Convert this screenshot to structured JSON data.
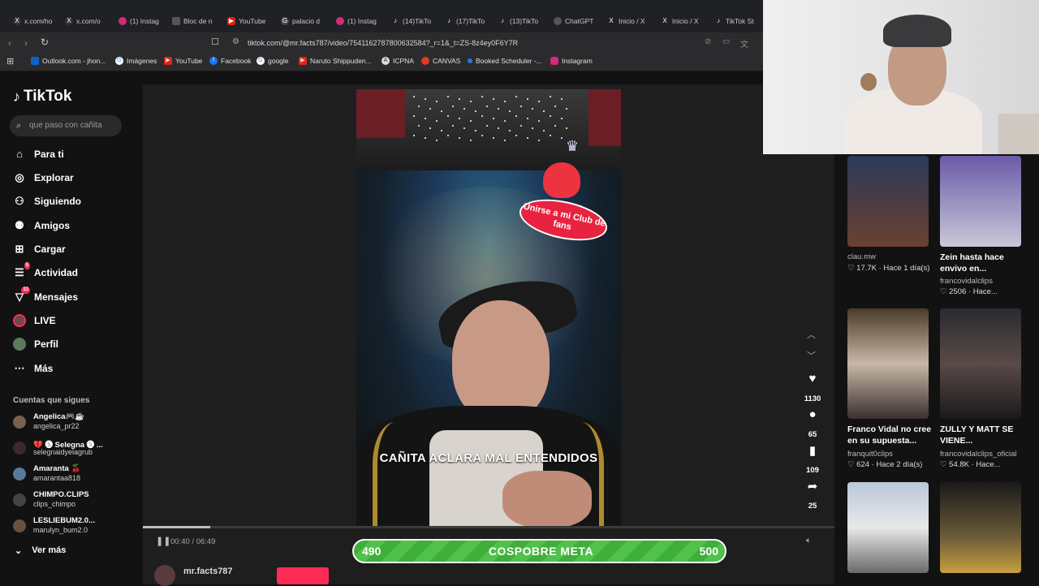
{
  "browser": {
    "tabs": [
      {
        "label": "x.com/ho",
        "icon": "x-icon"
      },
      {
        "label": "x.com/o",
        "icon": "x-icon"
      },
      {
        "label": "(1) Instag",
        "icon": "instagram-icon"
      },
      {
        "label": "Bloc de n",
        "icon": "notepad-icon"
      },
      {
        "label": "YouTube",
        "icon": "youtube-icon"
      },
      {
        "label": "palacio d",
        "icon": "google-icon"
      },
      {
        "label": "(1) Instag",
        "icon": "instagram-icon"
      },
      {
        "label": "(14)TikTo",
        "icon": "tiktok-icon"
      },
      {
        "label": "(17)TikTo",
        "icon": "tiktok-icon"
      },
      {
        "label": "(13)TikTo",
        "icon": "tiktok-icon"
      },
      {
        "label": "ChatGPT",
        "icon": "chatgpt-icon"
      },
      {
        "label": "Inicio / X",
        "icon": "x-icon"
      },
      {
        "label": "Inicio / X",
        "icon": "x-icon"
      },
      {
        "label": "TikTok St",
        "icon": "tiktok-icon"
      }
    ],
    "url": "tiktok.com/@mr.facts787/video/7541162787800632584?_r=1&_t=ZS-8z4ey0F6Y7R",
    "bookmarks": [
      {
        "label": "Outlook.com - jhon...",
        "icon": "outlook-icon"
      },
      {
        "label": "Imágenes",
        "icon": "google-icon"
      },
      {
        "label": "YouTube",
        "icon": "youtube-icon"
      },
      {
        "label": "Facebook",
        "icon": "facebook-icon"
      },
      {
        "label": "google",
        "icon": "google-icon"
      },
      {
        "label": "Naruto Shippuden...",
        "icon": "youtube-icon"
      },
      {
        "label": "ICPNA",
        "icon": "icpna-icon"
      },
      {
        "label": "CANVAS",
        "icon": "canvas-icon"
      },
      {
        "label": "Booked Scheduler -...",
        "icon": "booked-icon"
      },
      {
        "label": "Instagram",
        "icon": "instagram-icon"
      }
    ]
  },
  "sidebar": {
    "logo": "TikTok",
    "search_placeholder": "que paso con cañita",
    "nav": [
      {
        "label": "Para ti",
        "icon": "home-icon"
      },
      {
        "label": "Explorar",
        "icon": "compass-icon"
      },
      {
        "label": "Siguiendo",
        "icon": "following-icon"
      },
      {
        "label": "Amigos",
        "icon": "friends-icon"
      },
      {
        "label": "Cargar",
        "icon": "upload-icon"
      },
      {
        "label": "Actividad",
        "icon": "activity-icon",
        "badge": "5"
      },
      {
        "label": "Mensajes",
        "icon": "messages-icon",
        "badge": "13"
      },
      {
        "label": "LIVE",
        "icon": "live-icon"
      },
      {
        "label": "Perfil",
        "icon": "profile-icon"
      },
      {
        "label": "Más",
        "icon": "more-icon"
      }
    ],
    "following_title": "Cuentas que sigues",
    "accounts": [
      {
        "name": "Angelica🎮☕",
        "handle": "angelica_pr22"
      },
      {
        "name": "💔 🅢 Selegna 🅢 ...",
        "handle": "selegnaidyelagrub"
      },
      {
        "name": "Amaranta 🍒",
        "handle": "amarantaa818"
      },
      {
        "name": "CHIMPO.CLIPS",
        "handle": "clips_chimpo"
      },
      {
        "name": "LESLIEBUM2.0...",
        "handle": "marulyn_bum2.0"
      }
    ],
    "see_more": "Ver más"
  },
  "video": {
    "caption": "CAÑITA ACLARA MAL ENTENDIDOS",
    "fan_club": "Unirse a mi Club de fans",
    "time": "00:40 / 06:49",
    "progress": 0.098,
    "author": "mr.facts787"
  },
  "meta_bar": {
    "current": "490",
    "label": "COSPOBRE META",
    "goal": "500",
    "fraction": 0.98
  },
  "actions": {
    "likes": "1130",
    "comments": "65",
    "saves": "109",
    "shares": "25"
  },
  "recommended": [
    {
      "title": "",
      "user": "clau.mw",
      "stat": "♡ 17.7K · Hace 1 día(s)"
    },
    {
      "title": "Zein hasta hace envivo en...",
      "user": "francovidalclips",
      "stat": "♡ 2506 · Hace..."
    },
    {
      "title": "Franco Vidal no cree en su supuesta...",
      "user": "franquit0clips",
      "stat": "♡ 624 · Hace 2 día(s)"
    },
    {
      "title": "ZULLY Y MATT SE VIENE...",
      "user": "francovidalclips_oficial",
      "stat": "♡ 54.8K · Hace..."
    }
  ],
  "colors": {
    "accent": "#fe2c55",
    "meta_green": "#45b840",
    "background": "#121212"
  }
}
